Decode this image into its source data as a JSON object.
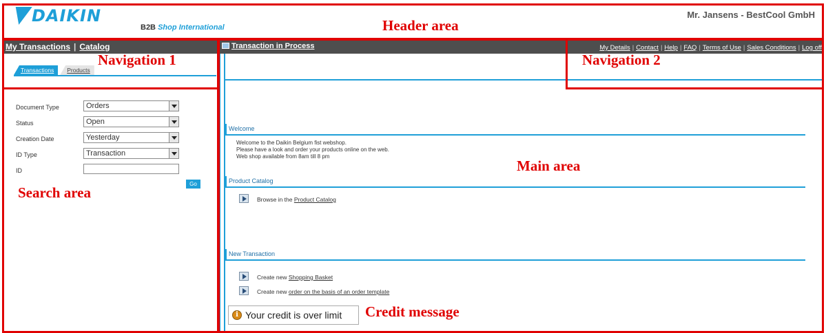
{
  "header": {
    "logo_text": "DAIKIN",
    "shop_prefix": "B2B",
    "shop_name": "Shop International",
    "user_info": "Mr. Jansens  - BestCool GmbH"
  },
  "nav1": {
    "items": [
      "My Transactions",
      "Catalog"
    ]
  },
  "tabs": [
    "Transactions",
    "Products"
  ],
  "transaction_link": "Transaction in Process",
  "nav2": {
    "items": [
      "My Details",
      "Contact",
      "Help",
      "FAQ",
      "Terms of Use",
      "Sales Conditions",
      "Log off"
    ]
  },
  "search": {
    "fields": [
      {
        "label": "Document Type",
        "value": "Orders"
      },
      {
        "label": "Status",
        "value": "Open"
      },
      {
        "label": "Creation Date",
        "value": "Yesterday"
      },
      {
        "label": "ID Type",
        "value": "Transaction"
      }
    ],
    "id_label": "ID",
    "id_value": "",
    "go_label": "Go"
  },
  "main": {
    "welcome": {
      "title": "Welcome",
      "lines": [
        "Welcome to the Daikin Belgium fist webshop.",
        "Please have a look and order your products online on the web.",
        "Web shop available from 8am till 8 pm"
      ]
    },
    "catalog": {
      "title": "Product Catalog",
      "text": "Browse in the ",
      "link": "Product Catalog"
    },
    "new_transaction": {
      "title": "New Transaction",
      "items": [
        {
          "text": "Create new ",
          "link": "Shopping Basket"
        },
        {
          "text": "Create new ",
          "link": "order on the basis of an order template"
        }
      ]
    },
    "credit": "Your credit is over limit"
  },
  "annotations": {
    "header": "Header area",
    "nav1": "Navigation 1",
    "nav2": "Navigation 2",
    "main": "Main area",
    "search": "Search area",
    "credit": "Credit message"
  },
  "colors": {
    "accent": "#1e9fd8",
    "navbar": "#4e4e4e",
    "annotation": "#e00000"
  }
}
